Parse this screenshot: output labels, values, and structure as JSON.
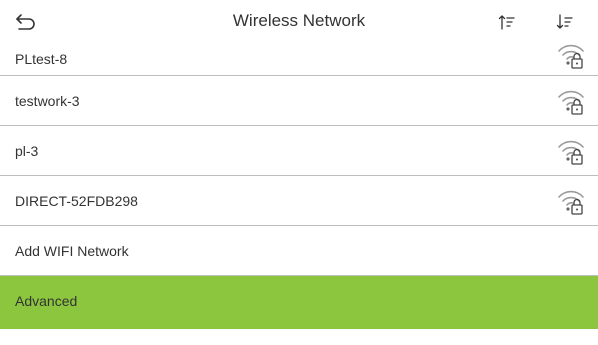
{
  "header": {
    "title": "Wireless Network"
  },
  "networks": [
    {
      "name": "PLtest-8",
      "icon": "wifi-lock-icon"
    },
    {
      "name": "testwork-3",
      "icon": "wifi-lock-icon"
    },
    {
      "name": "pl-3",
      "icon": "wifi-lock-icon"
    },
    {
      "name": "DIRECT-52FDB298",
      "icon": "wifi-lock-icon"
    }
  ],
  "actions": {
    "add_label": "Add WIFI Network",
    "advanced_label": "Advanced"
  },
  "colors": {
    "accent": "#8cc63f",
    "divider": "#bdbdbd",
    "icon": "#888888"
  }
}
